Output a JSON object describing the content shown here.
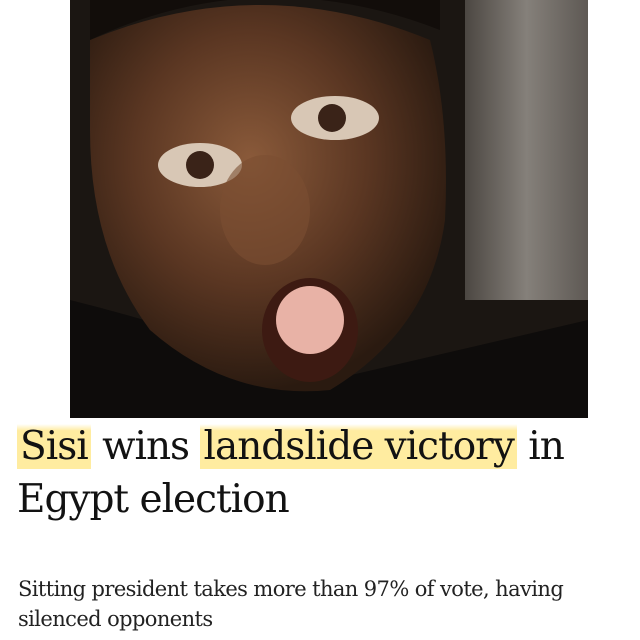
{
  "article": {
    "headline": {
      "part1": "Sisi",
      "part2": " wins ",
      "part3": "landslide victory",
      "part4": " in Egypt election"
    },
    "standfirst": "Sitting president takes more than 97% of vote, having silenced opponents"
  },
  "colors": {
    "highlight": "#ffe580",
    "headline_text": "#121212",
    "standfirst_text": "#222222"
  }
}
